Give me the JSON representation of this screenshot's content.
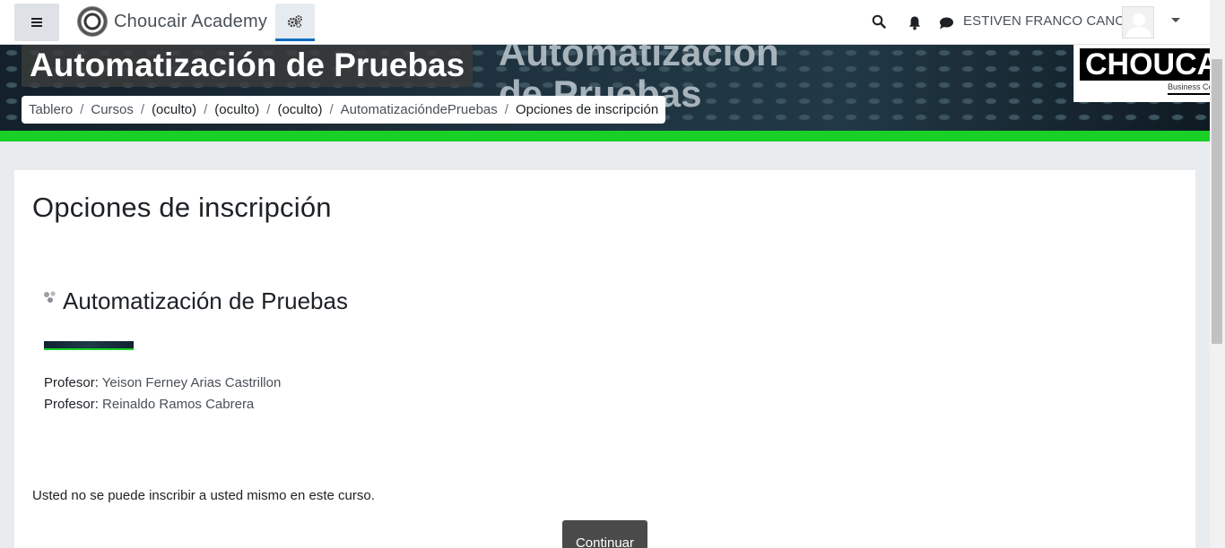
{
  "navbar": {
    "brand": "Choucair Academy",
    "user_name": "ESTIVEN FRANCO CANO"
  },
  "banner": {
    "course_title": "Automatización de Pruebas",
    "background_text_line1": "Automatización",
    "background_text_line2": "de Pruebas",
    "logo_text": "CHOUCAIR",
    "logo_subtext": "Business Centric Testing",
    "accent_color": "#19d126"
  },
  "breadcrumb": [
    {
      "label": "Tablero"
    },
    {
      "label": "Cursos"
    },
    {
      "label": "(oculto)"
    },
    {
      "label": "(oculto)"
    },
    {
      "label": "(oculto)"
    },
    {
      "label": "AutomatizacióndePruebas"
    },
    {
      "label": "Opciones de inscripción"
    }
  ],
  "main": {
    "page_title": "Opciones de inscripción",
    "course_name": "Automatización de Pruebas",
    "teachers": [
      {
        "role": "Profesor:",
        "name": "Yeison Ferney Arias Castrillon"
      },
      {
        "role": "Profesor:",
        "name": "Reinaldo Ramos Cabrera"
      }
    ],
    "notice": "Usted no se puede inscribir a usted mismo en este curso.",
    "continue_label": "Continuar"
  },
  "icons": {
    "menu": "hamburger-menu-icon",
    "gears": "gears-icon",
    "search": "search-icon",
    "notifications": "bell-icon",
    "messages": "speech-bubble-icon",
    "course": "course-icon"
  }
}
